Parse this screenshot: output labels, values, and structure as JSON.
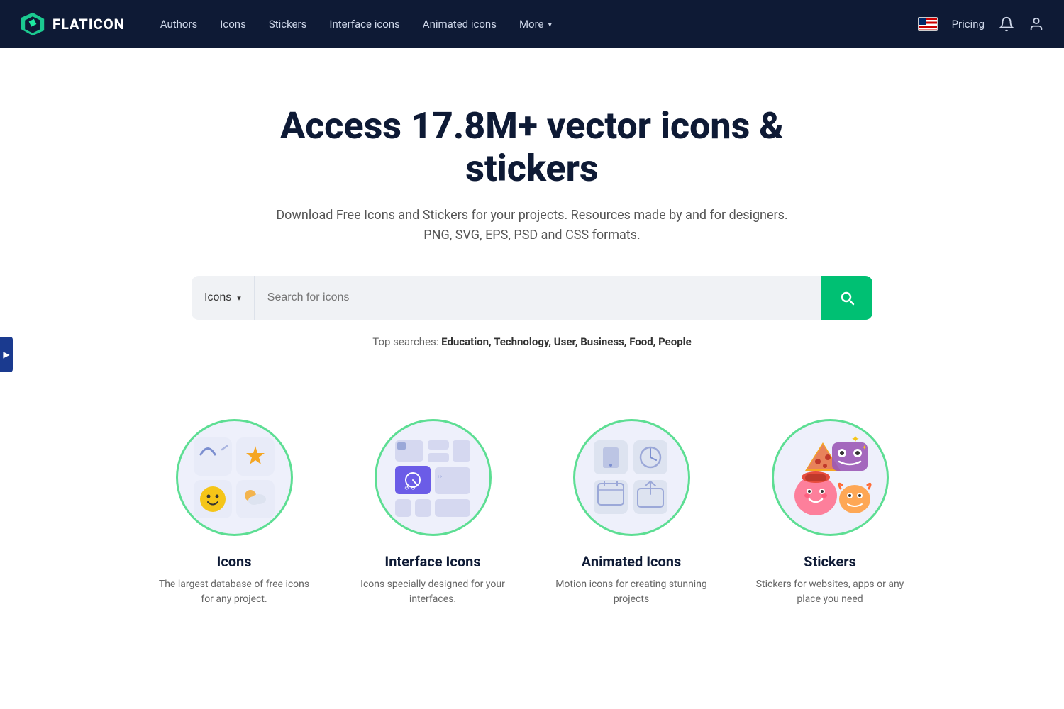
{
  "nav": {
    "logo_text": "FLATICON",
    "links": [
      {
        "label": "Authors",
        "name": "authors"
      },
      {
        "label": "Icons",
        "name": "icons"
      },
      {
        "label": "Stickers",
        "name": "stickers"
      },
      {
        "label": "Interface icons",
        "name": "interface-icons"
      },
      {
        "label": "Animated icons",
        "name": "animated-icons"
      },
      {
        "label": "More",
        "name": "more",
        "has_chevron": true
      }
    ],
    "pricing": "Pricing"
  },
  "hero": {
    "title": "Access 17.8M+ vector icons & stickers",
    "subtitle_line1": "Download Free Icons and Stickers for your projects. Resources made by and for designers.",
    "subtitle_line2": "PNG, SVG, EPS, PSD and CSS formats."
  },
  "search": {
    "dropdown_label": "Icons",
    "placeholder": "Search for icons",
    "top_searches_label": "Top searches:",
    "top_searches": "Education, Technology, User, Business, Food, People"
  },
  "categories": [
    {
      "name": "icons",
      "title": "Icons",
      "desc": "The largest database of free icons for any project."
    },
    {
      "name": "interface-icons",
      "title": "Interface Icons",
      "desc": "Icons specially designed for your interfaces."
    },
    {
      "name": "animated-icons",
      "title": "Animated Icons",
      "desc": "Motion icons for creating stunning projects"
    },
    {
      "name": "stickers",
      "title": "Stickers",
      "desc": "Stickers for websites, apps or any place you need"
    }
  ]
}
